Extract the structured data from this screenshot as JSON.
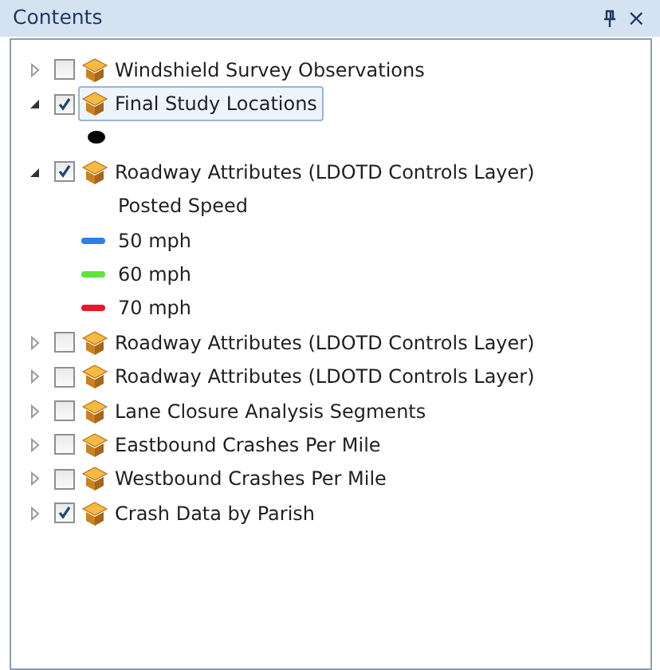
{
  "panel": {
    "title": "Contents",
    "buttons": [
      {
        "kind": "pin"
      },
      {
        "kind": "close",
        "label": "×"
      }
    ]
  },
  "layers": [
    {
      "name": "Windshield Survey Observations",
      "checked": false,
      "expanded": false,
      "selected": false
    },
    {
      "name": "Final Study Locations",
      "checked": true,
      "expanded": true,
      "selected": true,
      "legend": {
        "items": [
          {
            "kind": "point",
            "color": "#000000"
          }
        ]
      }
    },
    {
      "name": "Roadway Attributes (LDOTD Controls Layer)",
      "checked": true,
      "expanded": true,
      "selected": false,
      "legend": {
        "heading": "Posted Speed",
        "items": [
          {
            "kind": "line",
            "color": "#2f7fe8",
            "label": "50 mph"
          },
          {
            "kind": "line",
            "color": "#5ee43a",
            "label": "60 mph"
          },
          {
            "kind": "line",
            "color": "#e8182a",
            "label": "70 mph"
          }
        ]
      }
    },
    {
      "name": "Roadway Attributes (LDOTD Controls Layer)",
      "checked": false,
      "expanded": false,
      "selected": false
    },
    {
      "name": "Roadway Attributes (LDOTD Controls Layer)",
      "checked": false,
      "expanded": false,
      "selected": false
    },
    {
      "name": "Lane Closure Analysis Segments",
      "checked": false,
      "expanded": false,
      "selected": false
    },
    {
      "name": "Eastbound Crashes Per Mile",
      "checked": false,
      "expanded": false,
      "selected": false
    },
    {
      "name": "Westbound Crashes Per Mile",
      "checked": false,
      "expanded": false,
      "selected": false
    },
    {
      "name": "Crash Data by Parish",
      "checked": true,
      "expanded": false,
      "selected": false
    }
  ]
}
